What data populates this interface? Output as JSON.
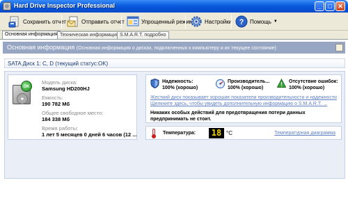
{
  "window": {
    "title": "Hard Drive Inspector Professional",
    "minimize": "_",
    "maximize": "□",
    "close": "✕"
  },
  "toolbar": {
    "save_report": "Сохранить отчет",
    "send_report": "Отправить отчет",
    "simple_mode": "Упрощенный режим",
    "settings": "Настройки",
    "help": "Помощь"
  },
  "tabs": [
    {
      "label": "Основная информация",
      "active": true
    },
    {
      "label": "Техническая информация",
      "active": false
    },
    {
      "label": "S.M.A.R.T. подробно",
      "active": false
    }
  ],
  "section": {
    "title": "Основная информация",
    "subtitle": "(Основная информация о дисках, подключенных к компьютеру и  их текущее состояние)"
  },
  "disk": {
    "heading": "SATA Диск 1: C, D (текущий статус:OK)",
    "status_badge": "OK",
    "model_label": "Модель диска:",
    "model_value": "Samsung HD200HJ",
    "capacity_label": "Емкость:",
    "capacity_value": "190 782 Мб",
    "free_label": "Общее свободное место:",
    "free_value": "184 338 Мб",
    "uptime_label": "Время работы:",
    "uptime_value": "1 лет 5 месяцев 0 дней 6 часов (12 ..."
  },
  "metrics": [
    {
      "name": "Надежность:",
      "value": "100% (хорошо)",
      "icon": "shield-icon"
    },
    {
      "name": "Производитель...",
      "value": "100% (хорошо)",
      "icon": "speedometer-icon"
    },
    {
      "name": "Отсутствие ошибок:",
      "value": "100% (хорошо)",
      "icon": "warning-triangle-icon"
    }
  ],
  "status": {
    "link_line1": "Жесткий диск показывает хорошие показатели производительности и надежности",
    "link_line2": "Щелкните здесь, чтобы увидеть дополнительную информацию о S.M.A.R.T. ...",
    "warning_line1": "Никаких особых действий для предотвращения потери данных",
    "warning_line2": "предпринимать не стоит."
  },
  "temperature": {
    "label": "Температура:",
    "value": "18",
    "unit": "°C",
    "chart_link": "Температурная диаграмма"
  },
  "colors": {
    "title_bar": "#0b5de0",
    "section_header": "#97a7c3",
    "link": "#5f7fc4",
    "ok_green": "#1d8b1d"
  }
}
